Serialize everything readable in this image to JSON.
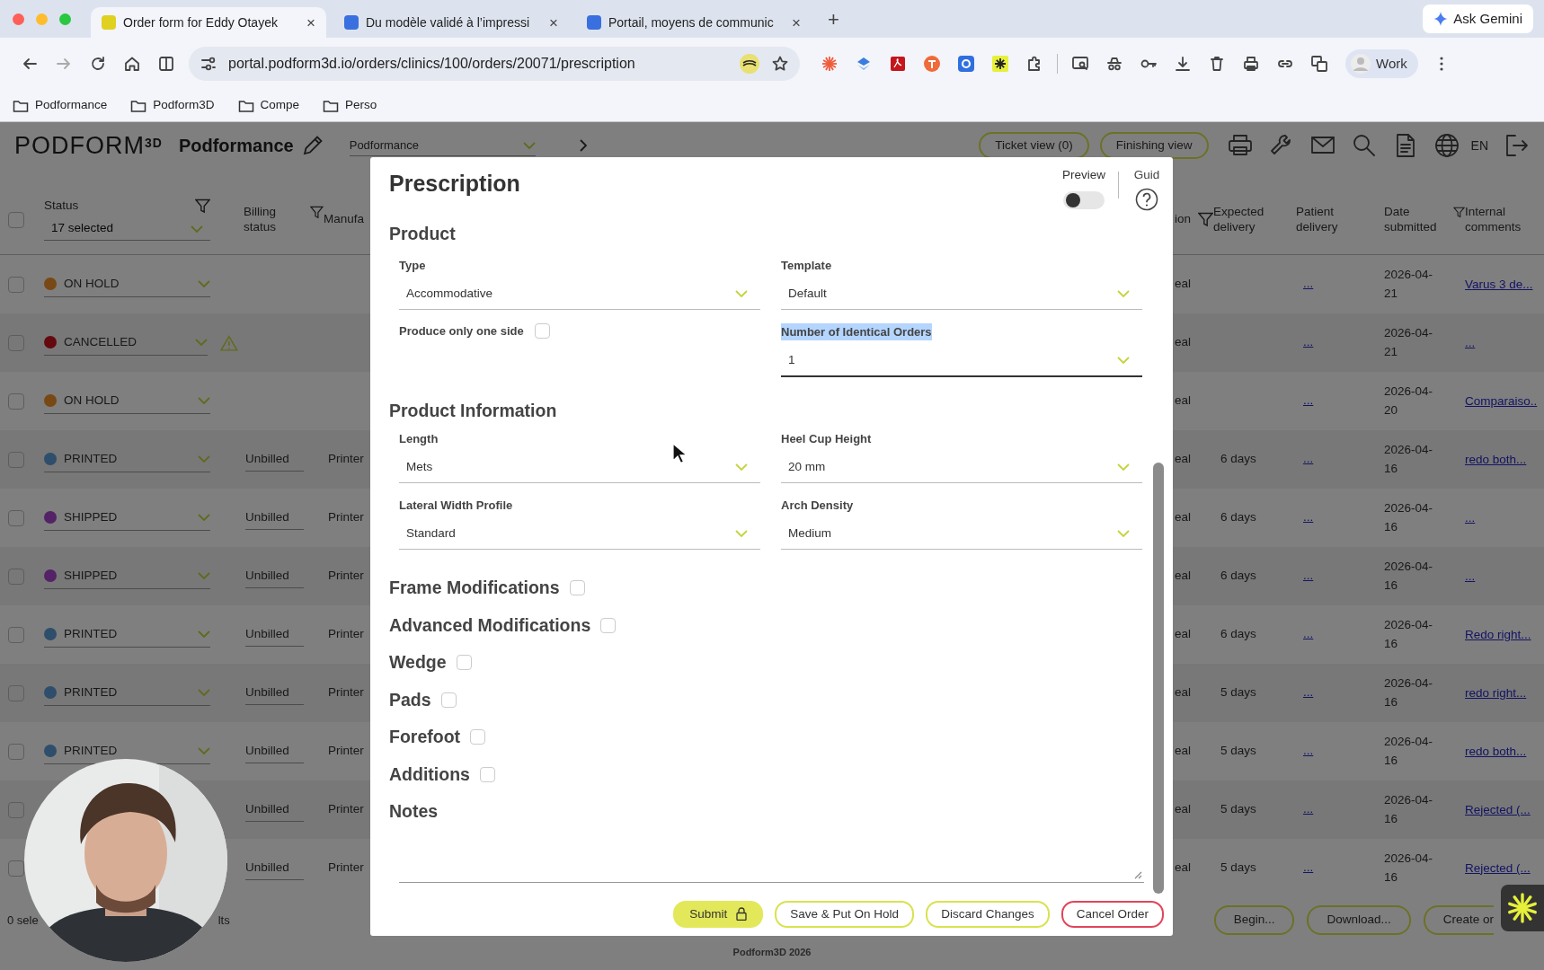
{
  "browser": {
    "tabs": [
      {
        "title": "Order form for Eddy Otayek",
        "selected": true,
        "close": "×"
      },
      {
        "title": "Du modèle validé à l’impressi",
        "selected": false,
        "close": "×"
      },
      {
        "title": "Portail, moyens de communic",
        "selected": false,
        "close": "×"
      }
    ],
    "new_tab": "+",
    "gemini": "Ask Gemini",
    "url": "portal.podform3d.io/orders/clinics/100/orders/20071/prescription",
    "profile": "Work",
    "bookmarks": [
      "Podformance",
      "Podform3D",
      "Compe",
      "Perso"
    ]
  },
  "app": {
    "logo": "PODFORM$^{3D}$",
    "clinic": "Podformance",
    "selector": "Podformance",
    "view_buttons": [
      "Ticket view (0)",
      "Finishing view"
    ],
    "language": "EN",
    "table": {
      "select_all": {
        "checked": false
      },
      "columns": [
        {
          "label": "Status",
          "filter": true,
          "value": "17 selected"
        },
        {
          "label": "Billing status",
          "filter": true
        },
        {
          "label": "Manufa",
          "filter": false
        },
        {
          "label": "ion",
          "filter": true
        },
        {
          "label": "Expected delivery",
          "filter": false
        },
        {
          "label": "Patient delivery",
          "filter": false
        },
        {
          "label": "Date submitted",
          "filter": true
        },
        {
          "label": "Internal comments",
          "filter": false
        }
      ],
      "rows": [
        {
          "checked": false,
          "status": {
            "label": "ON HOLD",
            "color": "#784815"
          },
          "warning": false,
          "column_4": "eal",
          "patient": "...",
          "date": "2026-04-21",
          "comment": "Varus 3 de..."
        },
        {
          "checked": false,
          "status": {
            "label": "CANCELLED",
            "color": "#640a0e"
          },
          "warning": true,
          "column_4": "eal",
          "patient": "...",
          "date": "2026-04-21",
          "comment": "..."
        },
        {
          "checked": false,
          "status": {
            "label": "ON HOLD",
            "color": "#784815"
          },
          "warning": false,
          "column_4": "eal",
          "patient": "...",
          "date": "2026-04-20",
          "comment": "Comparaiso.."
        },
        {
          "checked": false,
          "status": {
            "label": "PRINTED",
            "color": "#2e4e6b"
          },
          "warning": false,
          "billing": "Unbilled",
          "manufacturer": "Printer",
          "column_4": "eal",
          "expected": "6 days",
          "patient": "...",
          "date": "2026-04-16",
          "comment": "redo both..."
        },
        {
          "checked": false,
          "status": {
            "label": "SHIPPED",
            "color": "#542266"
          },
          "warning": false,
          "billing": "Unbilled",
          "manufacturer": "Printer",
          "column_4": "eal",
          "expected": "6 days",
          "patient": "...",
          "date": "2026-04-16",
          "comment": "..."
        },
        {
          "checked": false,
          "status": {
            "label": "SHIPPED",
            "color": "#542266"
          },
          "warning": false,
          "billing": "Unbilled",
          "manufacturer": "Printer",
          "column_4": "eal",
          "expected": "6 days",
          "patient": "...",
          "date": "2026-04-16",
          "comment": "..."
        },
        {
          "checked": false,
          "status": {
            "label": "PRINTED",
            "color": "#2e4e6b"
          },
          "warning": false,
          "billing": "Unbilled",
          "manufacturer": "Printer",
          "column_4": "eal",
          "expected": "6 days",
          "patient": "...",
          "date": "2026-04-16",
          "comment": "Redo right..."
        },
        {
          "checked": false,
          "status": {
            "label": "PRINTED",
            "color": "#2e4e6b"
          },
          "warning": false,
          "billing": "Unbilled",
          "manufacturer": "Printer",
          "column_4": "eal",
          "expected": "5 days",
          "patient": "...",
          "date": "2026-04-16",
          "comment": "redo right..."
        },
        {
          "checked": false,
          "status": {
            "label": "PRINTED",
            "color": "#2e4e6b"
          },
          "warning": false,
          "billing": "Unbilled",
          "manufacturer": "Printer",
          "column_4": "eal",
          "expected": "5 days",
          "patient": "...",
          "date": "2026-04-16",
          "comment": "redo both..."
        },
        {
          "checked": false,
          "billing": "Unbilled",
          "manufacturer": "Printer",
          "column_4": "eal",
          "expected": "5 days",
          "patient": "...",
          "date": "2026-04-16",
          "comment": "Rejected (..."
        },
        {
          "checked": false,
          "billing": "Unbilled",
          "manufacturer": "Printer",
          "column_4": "eal",
          "expected": "5 days",
          "patient": "...",
          "date": "2026-04-16",
          "comment": "Rejected (..."
        }
      ]
    },
    "footer": {
      "selection": "0 sele",
      "results": "lts",
      "actions": [
        "Begin...",
        "Download...",
        "Create or"
      ]
    },
    "copyright": "Podform3D 2026"
  },
  "modal": {
    "title": "Prescription",
    "preview": {
      "label": "Preview",
      "on": false
    },
    "guide": "Guid",
    "sections": [
      {
        "kind": "form",
        "title": "Product",
        "items": [
          {
            "kind": "select",
            "label": "Type",
            "value": "Accommodative",
            "highlighted": false,
            "focused": false
          },
          {
            "kind": "select",
            "label": "Template",
            "value": "Default",
            "highlighted": false,
            "focused": false
          },
          {
            "kind": "checkbox",
            "label": "Produce only one side",
            "checked": false
          },
          {
            "kind": "select",
            "label": "Number of Identical Orders",
            "value": "1",
            "highlighted": true,
            "focused": true
          }
        ]
      },
      {
        "kind": "form",
        "title": "Product Information",
        "items": [
          {
            "kind": "select",
            "label": "Length",
            "value": "Mets",
            "highlighted": false,
            "focused": false
          },
          {
            "kind": "select",
            "label": "Heel Cup Height",
            "value": "20 mm",
            "highlighted": false,
            "focused": false
          },
          {
            "kind": "select",
            "label": "Lateral Width Profile",
            "value": "Standard",
            "highlighted": false,
            "focused": false
          },
          {
            "kind": "select",
            "label": "Arch Density",
            "value": "Medium",
            "highlighted": false,
            "focused": false
          }
        ]
      },
      {
        "kind": "toggle",
        "title": "Frame Modifications",
        "checked": false
      },
      {
        "kind": "toggle",
        "title": "Advanced Modifications",
        "checked": false
      },
      {
        "kind": "toggle",
        "title": "Wedge",
        "checked": false
      },
      {
        "kind": "toggle",
        "title": "Pads",
        "checked": false
      },
      {
        "kind": "toggle",
        "title": "Forefoot",
        "checked": false
      },
      {
        "kind": "toggle",
        "title": "Additions",
        "checked": false
      },
      {
        "kind": "notes",
        "title": "Notes"
      }
    ],
    "buttons": [
      {
        "label": "Submit",
        "kind": "primary",
        "locked": true
      },
      {
        "label": "Save & Put On Hold",
        "kind": "outline",
        "locked": false
      },
      {
        "label": "Discard Changes",
        "kind": "outline",
        "locked": false
      },
      {
        "label": "Cancel Order",
        "kind": "danger",
        "locked": false
      }
    ]
  }
}
